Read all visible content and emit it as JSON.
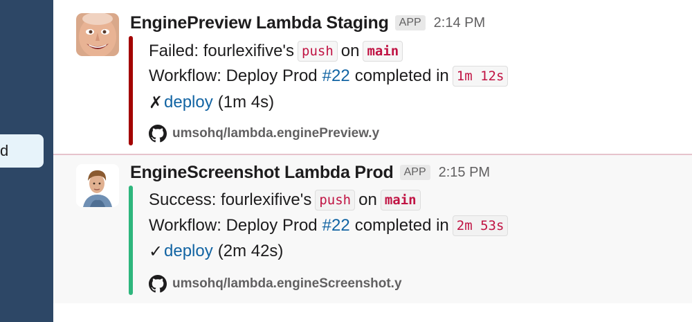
{
  "sidebar": {
    "active_item_label": "d"
  },
  "messages": [
    {
      "sender": "EnginePreview Lambda Staging",
      "badge": "APP",
      "time": "2:14 PM",
      "status_color": "#a30200",
      "line1": {
        "prefix": "Failed: fourlexifive's",
        "event": "push",
        "on": "on",
        "branch": "main"
      },
      "line2": {
        "prefix": "Workflow: Deploy Prod",
        "run_link": "#22",
        "middle": "completed in",
        "duration": "1m 12s"
      },
      "line3": {
        "mark": "✗",
        "job_link": "deploy",
        "job_duration": "(1m 4s)"
      },
      "footer": {
        "icon": "github-icon",
        "repo": "umsohq/lambda.enginePreview.y"
      }
    },
    {
      "sender": "EngineScreenshot Lambda Prod",
      "badge": "APP",
      "time": "2:15 PM",
      "status_color": "#2eb67d",
      "line1": {
        "prefix": "Success: fourlexifive's",
        "event": "push",
        "on": "on",
        "branch": "main"
      },
      "line2": {
        "prefix": "Workflow: Deploy Prod",
        "run_link": "#22",
        "middle": "completed in",
        "duration": "2m 53s"
      },
      "line3": {
        "mark": "✓",
        "job_link": "deploy",
        "job_duration": "(2m 42s)"
      },
      "footer": {
        "icon": "github-icon",
        "repo": "umsohq/lambda.engineScreenshot.y"
      }
    }
  ]
}
